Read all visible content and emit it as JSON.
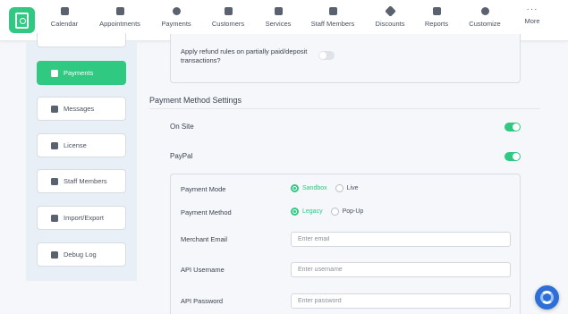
{
  "nav": {
    "items": [
      {
        "label": "Calendar",
        "icon": "calendar-icon"
      },
      {
        "label": "Appointments",
        "icon": "appointments-icon"
      },
      {
        "label": "Payments",
        "icon": "dollar-icon"
      },
      {
        "label": "Customers",
        "icon": "customers-icon"
      },
      {
        "label": "Services",
        "icon": "services-icon"
      },
      {
        "label": "Staff Members",
        "icon": "staff-icon"
      },
      {
        "label": "Discounts",
        "icon": "tag-icon"
      },
      {
        "label": "Reports",
        "icon": "reports-icon"
      },
      {
        "label": "Customize",
        "icon": "palette-icon"
      },
      {
        "label": "More",
        "icon": "more-dots-icon"
      }
    ]
  },
  "sidebar": {
    "items": [
      {
        "label": "Payments",
        "active": true
      },
      {
        "label": "Messages"
      },
      {
        "label": "License"
      },
      {
        "label": "Staff Members"
      },
      {
        "label": "Import/Export"
      },
      {
        "label": "Debug Log"
      }
    ]
  },
  "refund": {
    "text": "Apply refund rules on partially paid/deposit transactions?",
    "enabled": false
  },
  "payment_settings": {
    "title": "Payment Method Settings",
    "on_site": {
      "label": "On Site",
      "enabled": true
    },
    "paypal": {
      "label": "PayPal",
      "enabled": true
    }
  },
  "paypal_form": {
    "mode": {
      "label": "Payment Mode",
      "options": [
        "Sandbox",
        "Live"
      ],
      "selected": "Sandbox"
    },
    "method": {
      "label": "Payment Method",
      "options": [
        "Legacy",
        "Pop-Up"
      ],
      "selected": "Legacy"
    },
    "merchant_email": {
      "label": "Merchant Email",
      "placeholder": "Enter email"
    },
    "api_username": {
      "label": "API Username",
      "placeholder": "Enter username"
    },
    "api_password": {
      "label": "API Password",
      "placeholder": "Enter password"
    }
  },
  "colors": {
    "accent": "#2fc982",
    "help": "#2d6fd6"
  }
}
